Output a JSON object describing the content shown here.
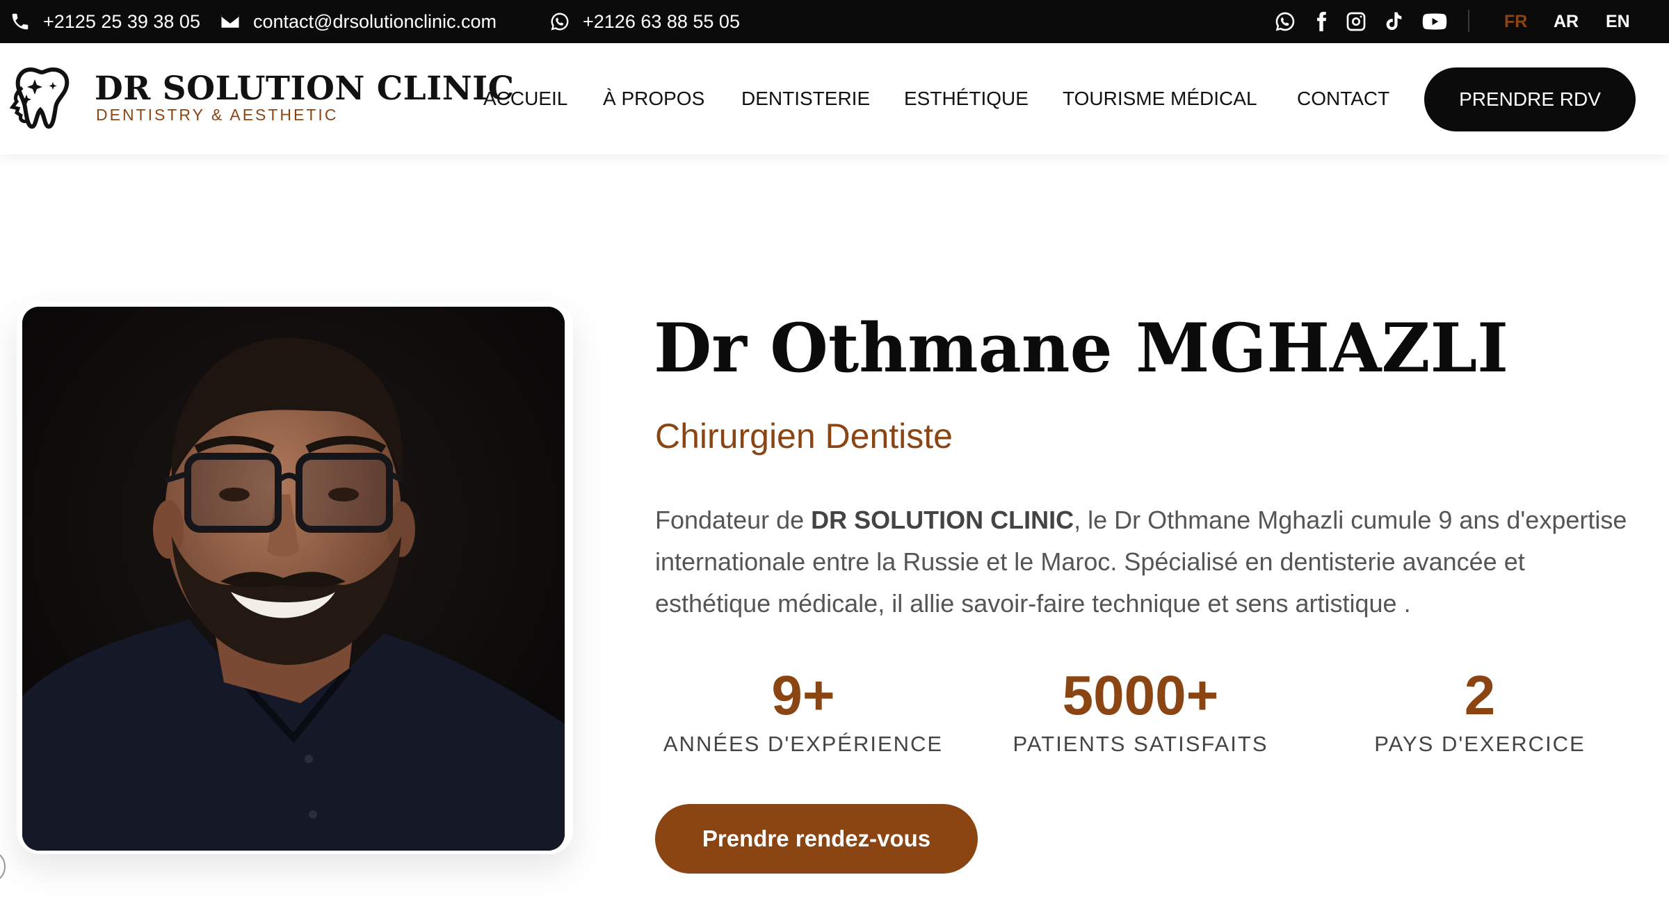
{
  "topbar": {
    "phone": "+2125 25 39 38 05",
    "email": "contact@drsolutionclinic.com",
    "whatsapp": "+2126 63 88 55 05",
    "social_icons": [
      "whatsapp-icon",
      "facebook-icon",
      "instagram-icon",
      "tiktok-icon",
      "youtube-icon"
    ],
    "languages": [
      {
        "code": "FR",
        "active": true
      },
      {
        "code": "AR",
        "active": false
      },
      {
        "code": "EN",
        "active": false
      }
    ]
  },
  "header": {
    "brand_title": "DR SOLUTION CLINIC",
    "brand_subtitle": "DENTISTRY & AESTHETIC",
    "nav": [
      "ACCUEIL",
      "À PROPOS",
      "DENTISTERIE",
      "ESTHÉTIQUE",
      "TOURISME MÉDICAL",
      "CONTACT"
    ],
    "cta": "PRENDRE RDV"
  },
  "hero": {
    "name": "Dr Othmane MGHAZLI",
    "role": "Chirurgien Dentiste",
    "bio": {
      "pre": "Fondateur de ",
      "bold": "DR SOLUTION CLINIC",
      "post": ", le Dr Othmane Mghazli cumule 9 ans d'expertise internationale entre la Russie et le Maroc. Spécialisé en dentisterie avancée et esthétique médicale, il allie savoir-faire technique et sens artistique ."
    },
    "stats": [
      {
        "value": "9+",
        "label": "ANNÉES D'EXPÉRIENCE"
      },
      {
        "value": "5000+",
        "label": "PATIENTS SATISFAITS"
      },
      {
        "value": "2",
        "label": "PAYS D'EXERCICE"
      }
    ],
    "cta": "Prendre rendez-vous"
  },
  "colors": {
    "accent": "#8b4513",
    "dark": "#0b0b0b",
    "text_muted": "#555555"
  }
}
